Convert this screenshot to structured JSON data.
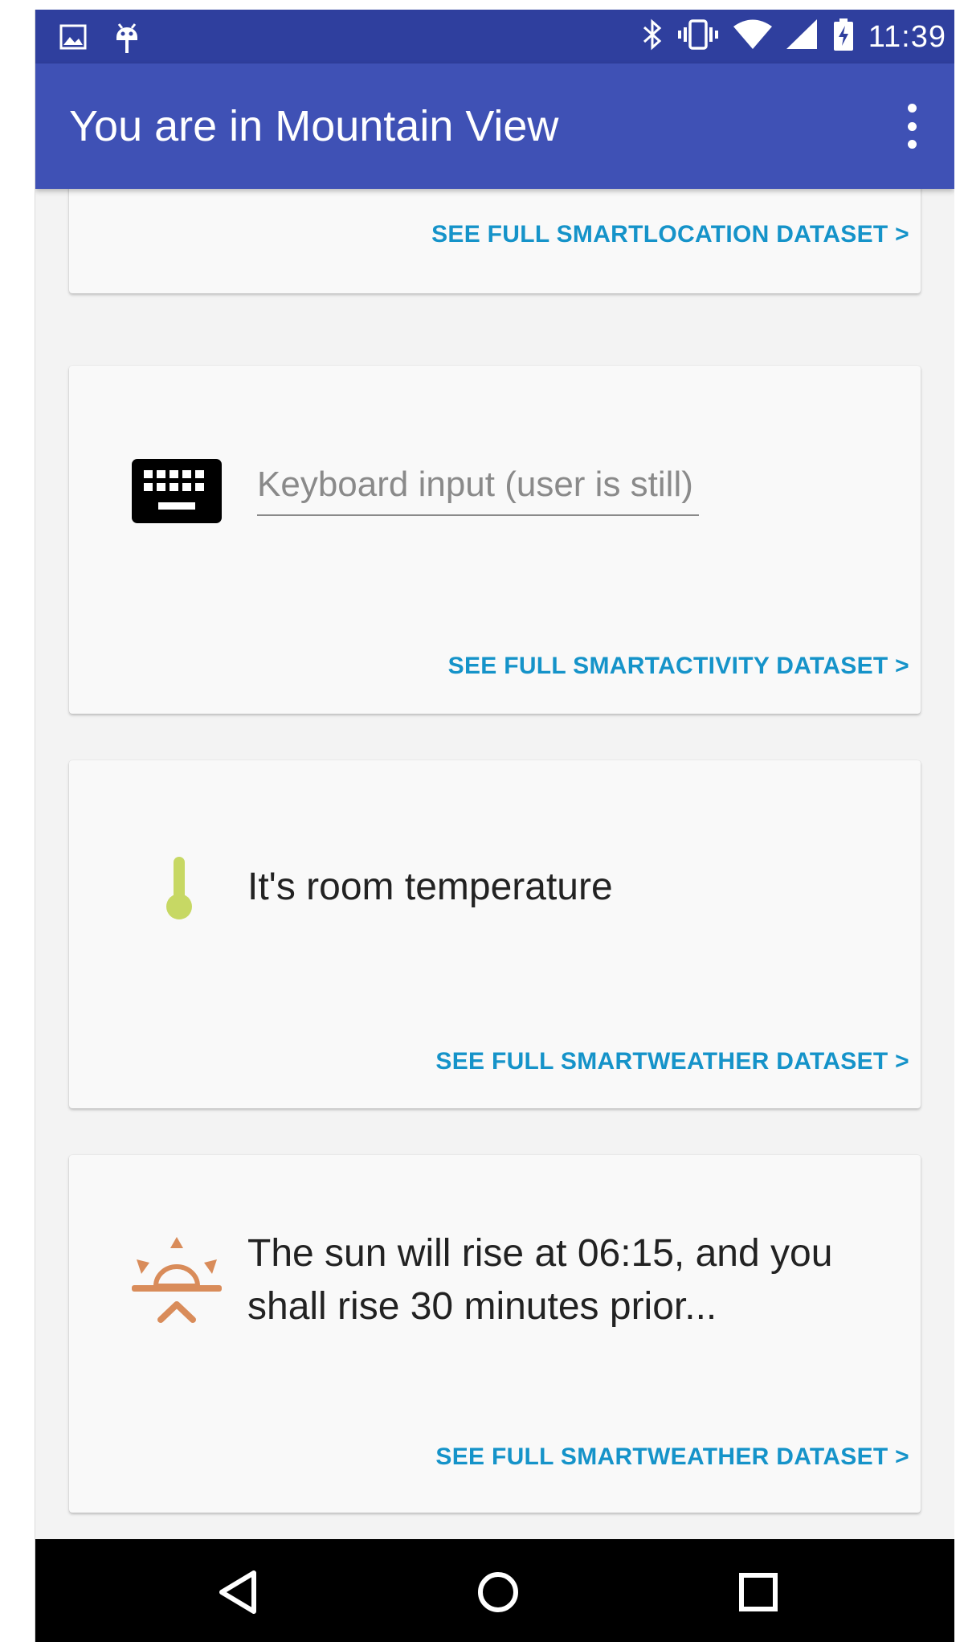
{
  "status_bar": {
    "time": "11:39",
    "left_icons": [
      "image-icon",
      "android-debug-icon"
    ],
    "right_icons": [
      "bluetooth-icon",
      "vibrate-icon",
      "wifi-icon",
      "cell-signal-icon",
      "battery-charging-icon"
    ]
  },
  "app_bar": {
    "title": "You are in Mountain View",
    "menu_icon": "more-vert-icon"
  },
  "cards": {
    "location": {
      "link": "SEE FULL SMARTLOCATION DATASET >"
    },
    "activity": {
      "icon": "keyboard-icon",
      "input_value": "Keyboard input (user is still)",
      "link": "SEE FULL SMARTACTIVITY DATASET >"
    },
    "temperature": {
      "icon": "thermometer-icon",
      "text": "It's room temperature",
      "link": "SEE FULL SMARTWEATHER DATASET >"
    },
    "sunrise": {
      "icon": "sunrise-icon",
      "text_line1": "The sun will rise at 06:15, and you",
      "text_line2": "shall rise 30 minutes prior...",
      "link": "SEE FULL SMARTWEATHER DATASET >"
    }
  },
  "nav_bar": {
    "buttons": [
      "back-icon",
      "home-icon",
      "recents-icon"
    ]
  },
  "colors": {
    "status_bar": "#2f3f9e",
    "app_bar": "#3f51b5",
    "link": "#1593c9",
    "thermometer": "#c7d864",
    "sunrise": "#d98c5a"
  }
}
